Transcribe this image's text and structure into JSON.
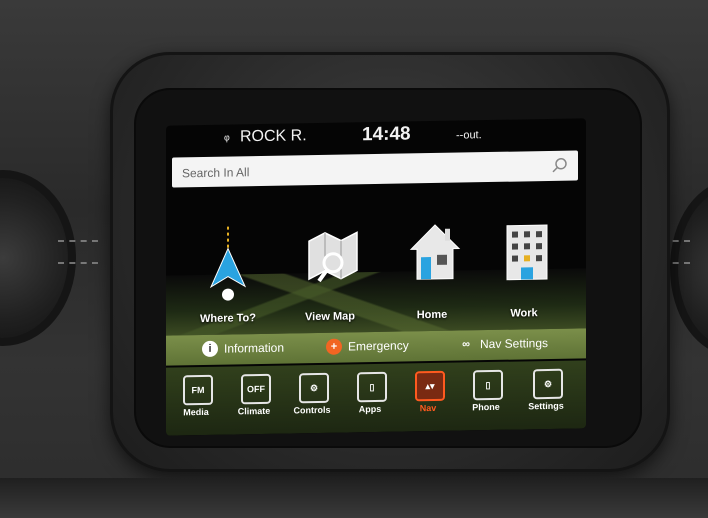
{
  "status": {
    "radio_icon": "radio-signal-icon",
    "radio_station": "ROCK R.",
    "time": "14:48",
    "outside_temp": "--out."
  },
  "search": {
    "placeholder": "Search In All"
  },
  "tiles": [
    {
      "label": "Where To?",
      "icon": "navigation-arrow-icon"
    },
    {
      "label": "View Map",
      "icon": "map-magnifier-icon"
    },
    {
      "label": "Home",
      "icon": "house-icon"
    },
    {
      "label": "Work",
      "icon": "office-building-icon"
    }
  ],
  "actions": [
    {
      "label": "Information",
      "icon": "info-icon",
      "icon_text": "i",
      "color": "#ffffff"
    },
    {
      "label": "Emergency",
      "icon": "emergency-plus-icon",
      "icon_text": "+",
      "color": "#f26522"
    },
    {
      "label": "Nav Settings",
      "icon": "link-settings-icon",
      "icon_text": "∞",
      "color": "#ffffff"
    }
  ],
  "dock": [
    {
      "label": "Media",
      "box": "FM"
    },
    {
      "label": "Climate",
      "box": "OFF"
    },
    {
      "label": "Controls",
      "box": "⚙"
    },
    {
      "label": "Apps",
      "box": "▯"
    },
    {
      "label": "Nav",
      "box": "▴▾",
      "active": true
    },
    {
      "label": "Phone",
      "box": "▯"
    },
    {
      "label": "Settings",
      "box": "⚙"
    }
  ],
  "colors": {
    "accent": "#ff5a1f",
    "bar": "#7b8f4a"
  }
}
